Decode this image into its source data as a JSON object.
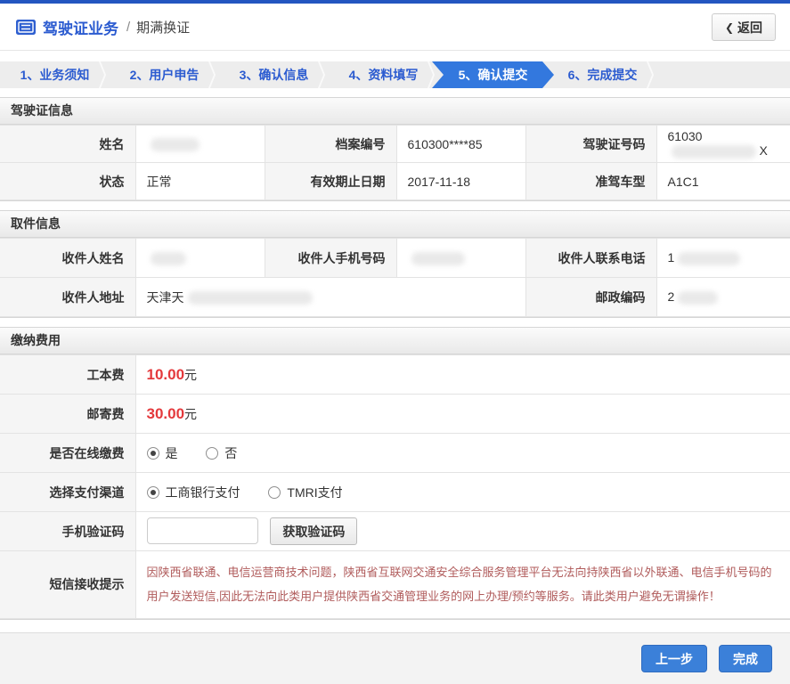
{
  "colors": {
    "accent_blue": "#2b5bd0",
    "active_tab_blue": "#3378de",
    "fee_red": "#e4393c",
    "notice_red": "#b05b5b"
  },
  "header": {
    "title": "驾驶证业务",
    "separator": "/",
    "subtitle": "期满换证",
    "back_icon": "❮",
    "back_label": "返回"
  },
  "steps": [
    {
      "label": "1、业务须知",
      "active": false
    },
    {
      "label": "2、用户申告",
      "active": false
    },
    {
      "label": "3、确认信息",
      "active": false
    },
    {
      "label": "4、资料填写",
      "active": false
    },
    {
      "label": "5、确认提交",
      "active": true
    },
    {
      "label": "6、完成提交",
      "active": false
    }
  ],
  "license_info": {
    "section_title": "驾驶证信息",
    "fields": [
      {
        "label": "姓名",
        "value": "",
        "redacted": true
      },
      {
        "label": "档案编号",
        "value": "610300****85"
      },
      {
        "label": "驾驶证号码",
        "prefix": "61030",
        "suffix": "X",
        "redacted": true
      },
      {
        "label": "状态",
        "value": "正常"
      },
      {
        "label": "有效期止日期",
        "value": "2017-11-18"
      },
      {
        "label": "准驾车型",
        "value": "A1C1"
      }
    ]
  },
  "pickup_info": {
    "section_title": "取件信息",
    "fields": [
      {
        "label": "收件人姓名",
        "value": "",
        "redacted": true
      },
      {
        "label": "收件人手机号码",
        "value": "",
        "redacted": true
      },
      {
        "label": "收件人联系电话",
        "prefix": "1",
        "redacted": true
      },
      {
        "label": "收件人地址",
        "prefix": "天津天",
        "redacted": true
      },
      {
        "label": "邮政编码",
        "prefix": "2",
        "redacted": true
      }
    ]
  },
  "payment": {
    "section_title": "缴纳费用",
    "production_fee": {
      "label": "工本费",
      "amount": "10.00",
      "unit": "元"
    },
    "postage_fee": {
      "label": "邮寄费",
      "amount": "30.00",
      "unit": "元"
    },
    "online_payment": {
      "label": "是否在线缴费",
      "options": [
        {
          "label": "是",
          "selected": true
        },
        {
          "label": "否",
          "selected": false
        }
      ]
    },
    "payment_channel": {
      "label": "选择支付渠道",
      "options": [
        {
          "label": "工商银行支付",
          "selected": true
        },
        {
          "label": "TMRI支付",
          "selected": false
        }
      ]
    },
    "sms_code": {
      "label": "手机验证码",
      "input_value": "",
      "button_label": "获取验证码"
    },
    "sms_notice": {
      "label": "短信接收提示",
      "text": "因陕西省联通、电信运营商技术问题，陕西省互联网交通安全综合服务管理平台无法向持陕西省以外联通、电信手机号码的用户发送短信,因此无法向此类用户提供陕西省交通管理业务的网上办理/预约等服务。请此类用户避免无谓操作！"
    }
  },
  "footer": {
    "prev_label": "上一步",
    "finish_label": "完成"
  }
}
